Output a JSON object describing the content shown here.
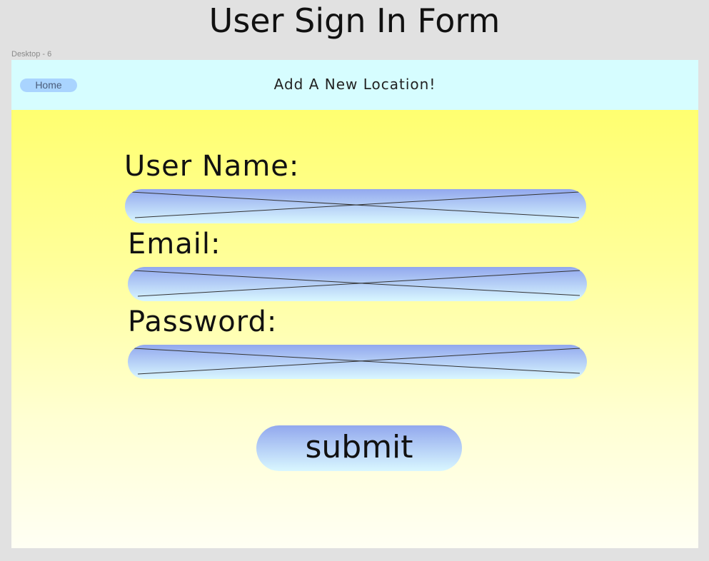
{
  "page": {
    "title": "User Sign In Form",
    "frame_label": "Desktop - 6"
  },
  "nav": {
    "home_label": "Home",
    "title": "Add A New Location!"
  },
  "form": {
    "username_label": "User Name:",
    "email_label": "Email:",
    "password_label": "Password:",
    "submit_label": "submit"
  },
  "colors": {
    "background": "#e1e1e1",
    "nav_background": "#d6fdff",
    "home_button": "#a9d4ff",
    "body_gradient_top": "#ffff70",
    "body_gradient_bottom": "#fffff4",
    "input_gradient_top": "#92a8ee",
    "input_gradient_bottom": "#d9f7ff"
  }
}
